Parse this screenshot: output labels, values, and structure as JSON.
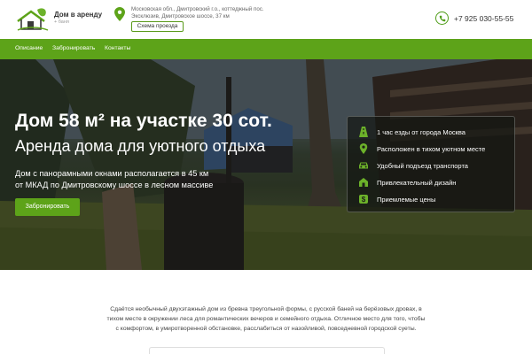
{
  "brand": {
    "title": "Дом в аренду",
    "subtitle": "+ баня",
    "logo_icon": "house-logo-icon"
  },
  "header": {
    "address_line1": "Московская обл., Дмитровский г.о., коттеджный пос.",
    "address_line2": "Эксклюзив, Дмитровское шоссе, 37 км",
    "route_button": "Схема проезда",
    "phone": "+7 925 030-55-55",
    "accent_color": "#5da319"
  },
  "nav": {
    "items": [
      {
        "label": "Описание"
      },
      {
        "label": "Забронировать"
      },
      {
        "label": "Контакты"
      }
    ]
  },
  "hero": {
    "title": "Дом 58 м² на участке 30 сот.",
    "subtitle": "Аренда дома для уютного отдыха",
    "desc_line1": "Дом с панорамными окнами располагается в 45 км",
    "desc_line2": "от МКАД по Дмитровскому шоссе в лесном массиве",
    "button": "Забронировать",
    "features": [
      {
        "icon": "road-icon",
        "label": "1 час езды от города Москва"
      },
      {
        "icon": "location-icon",
        "label": "Расположен в тихом уютном месте"
      },
      {
        "icon": "car-icon",
        "label": "Удобный подъезд транспорта"
      },
      {
        "icon": "design-icon",
        "label": "Привлекательный дизайн"
      },
      {
        "icon": "money-icon",
        "label": "Приемлемые цены"
      }
    ]
  },
  "about": {
    "line1": "Сдаётся необычный двухэтажный дом из бревна треугольной формы, с русской баней на берёзовых дровах, в",
    "line2": "тихом месте в окружении леса для романтических вечеров и семейного отдыха. Отличное место для того, чтобы",
    "line3": "с комфортом, в умиротворенной обстановке, расслабиться от назойливой, повседневной городской суеты."
  }
}
